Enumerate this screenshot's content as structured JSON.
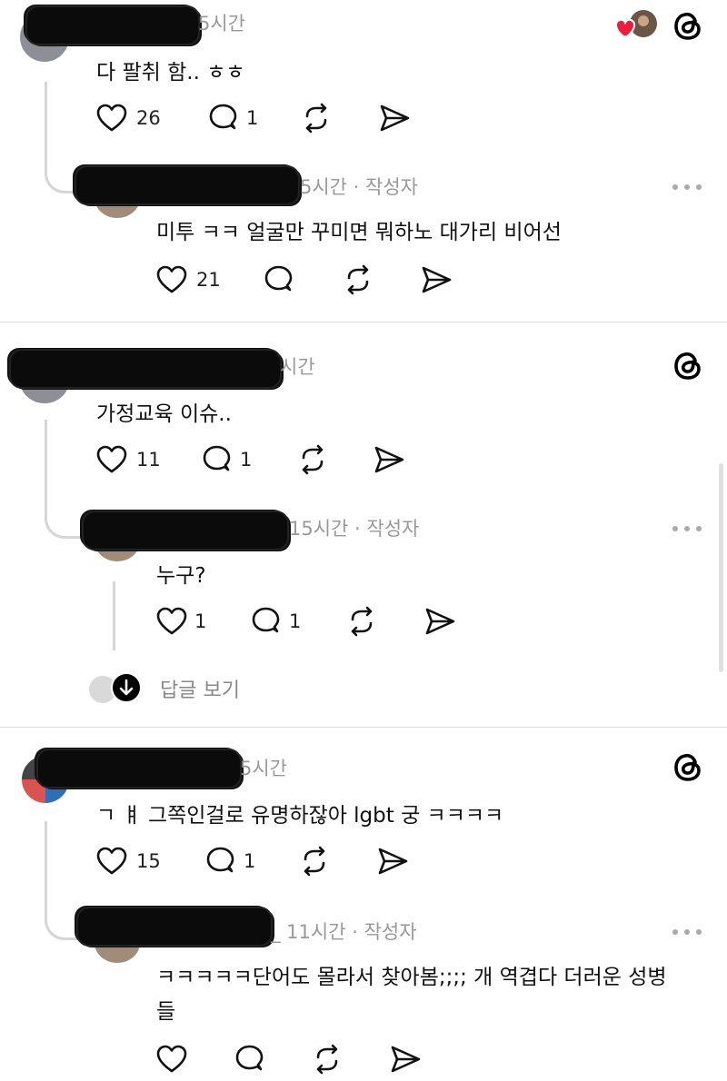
{
  "threads": [
    {
      "post": {
        "time": "5시간",
        "text": "다 팔취 함.. ㅎㅎ",
        "likes": "26",
        "replies": "1"
      },
      "reply": {
        "time": "5시간 · 작성자",
        "text": "미투 ㅋㅋ 얼굴만 꾸미면 뭐하노 대가리 비어선",
        "likes": "21"
      }
    },
    {
      "post": {
        "time": "시간",
        "text": "가정교육 이슈..",
        "likes": "11",
        "replies": "1"
      },
      "reply": {
        "time": "15시간 · 작성자",
        "text": "누구?",
        "likes": "1",
        "replies": "1"
      },
      "show_replies": "답글 보기"
    },
    {
      "post": {
        "time": "5시간",
        "text": "ㄱ ㅒ 그쪽인걸로 유명하잖아 lgbt 궁 ㅋㅋㅋㅋ",
        "likes": "15",
        "replies": "1"
      },
      "reply": {
        "time": "_ 11시간 · 작성자",
        "text_line1": "ㅋㅋㅋㅋㅋ단어도 몰라서 찾아봄;;;; 개 역겹다 더러운 성병",
        "text_line2": "들"
      }
    }
  ],
  "icons": {
    "like": "heart-icon",
    "comment": "comment-bubble-icon",
    "repost": "repost-icon",
    "share": "send-icon",
    "brand": "threads-logo-icon",
    "more": "more-dots-icon",
    "liked_by_author": "red-heart-icon"
  },
  "colors": {
    "heart_red": "#ee1d3a",
    "muted_text": "#999999",
    "divider": "#dcdcdc"
  }
}
